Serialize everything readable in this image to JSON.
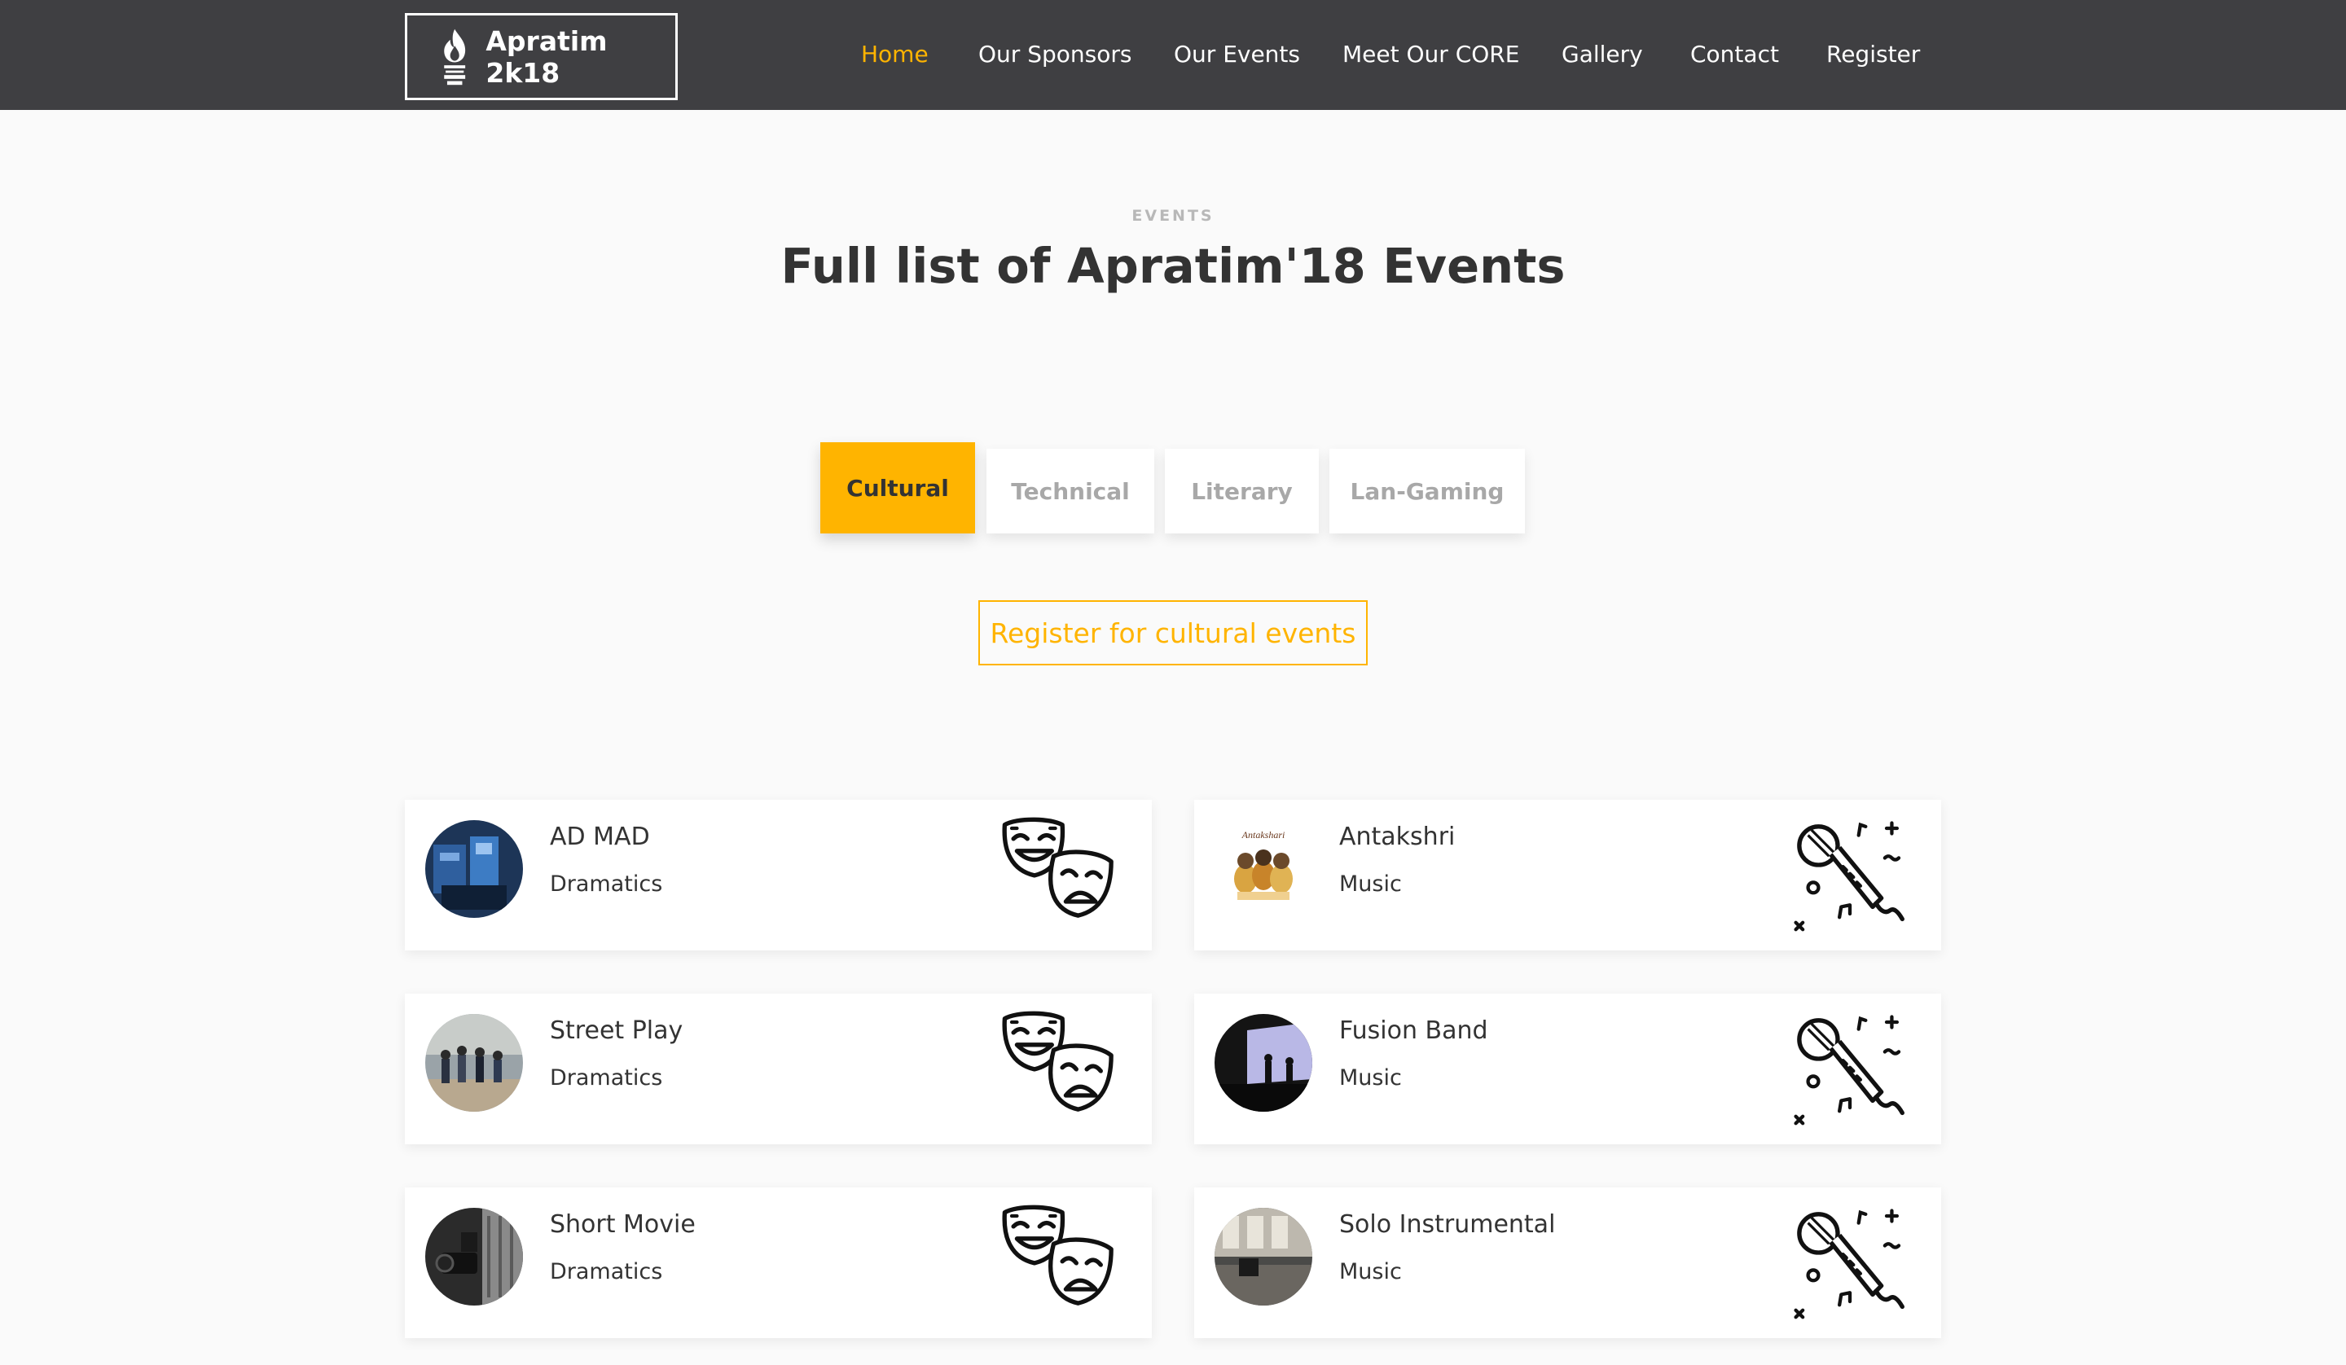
{
  "navbar": {
    "brand": "Apratim 2k18",
    "links": [
      {
        "label": "Home",
        "active": true
      },
      {
        "label": "Our Sponsors",
        "active": false
      },
      {
        "label": "Our Events",
        "active": false
      },
      {
        "label": "Meet Our CORE",
        "active": false
      },
      {
        "label": "Gallery",
        "active": false
      },
      {
        "label": "Contact",
        "active": false
      },
      {
        "label": "Register",
        "active": false
      }
    ]
  },
  "section": {
    "eyebrow": "EVENTS",
    "title": "Full list of Apratim'18 Events"
  },
  "tabs": [
    {
      "label": "Cultural",
      "active": true
    },
    {
      "label": "Technical",
      "active": false
    },
    {
      "label": "Literary",
      "active": false
    },
    {
      "label": "Lan-Gaming",
      "active": false
    }
  ],
  "register_cta": "Register for cultural events",
  "events": [
    {
      "title": "AD MAD",
      "category": "Dramatics",
      "icon": "theater-masks-icon"
    },
    {
      "title": "Antakshri",
      "category": "Music",
      "icon": "microphone-icon"
    },
    {
      "title": "Street Play",
      "category": "Dramatics",
      "icon": "theater-masks-icon"
    },
    {
      "title": "Fusion Band",
      "category": "Music",
      "icon": "microphone-icon"
    },
    {
      "title": "Short Movie",
      "category": "Dramatics",
      "icon": "theater-masks-icon"
    },
    {
      "title": "Solo Instrumental",
      "category": "Music",
      "icon": "microphone-icon"
    }
  ],
  "colors": {
    "accent": "#ffb400",
    "navbar_bg": "#3f3f42",
    "page_bg": "#fafafa",
    "text_dark": "#333333"
  }
}
